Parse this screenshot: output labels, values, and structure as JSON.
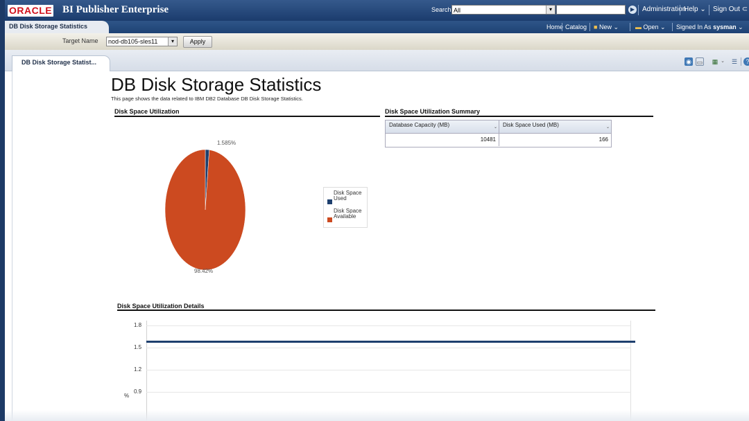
{
  "header": {
    "logo": "ORACLE",
    "app_name": "BI Publisher Enterprise",
    "search_label": "Search",
    "search_scope": "All",
    "links": [
      "Administration",
      "Help",
      "Sign Out"
    ]
  },
  "nav": {
    "active_tab": "DB Disk Storage Statistics",
    "home": "Home",
    "catalog": "Catalog",
    "new": "New",
    "open": "Open",
    "signed_in_label": "Signed In As",
    "user": "sysman"
  },
  "params": {
    "target_name_label": "Target Name",
    "target_name_value": "nod-db105-sles11",
    "apply_label": "Apply"
  },
  "report_tab": "DB Disk Storage Statist...",
  "report": {
    "title": "DB Disk Storage Statistics",
    "description": "This page shows the data related to IBM DB2 Database DB Disk Storage Statistics.",
    "sections": {
      "utilization": "Disk Space Utilization",
      "summary": "Disk Space Utilization Summary",
      "details": "Disk Space Utilization Details"
    },
    "summary_table": {
      "headers": [
        "Database Capacity (MB)",
        "Disk Space Used (MB)"
      ],
      "row": [
        "10481",
        "166"
      ]
    }
  },
  "chart_data": [
    {
      "type": "pie",
      "labels": [
        "1.585%",
        "98.42%"
      ],
      "series": [
        {
          "name": "Disk Space Used",
          "value": 1.585
        },
        {
          "name": "Disk Space Available",
          "value": 98.42
        }
      ],
      "legend": [
        "Disk Space Used",
        "Disk Space Available"
      ],
      "legend_placement": "right",
      "colors": [
        "#1e3f6e",
        "#cc4a20"
      ]
    },
    {
      "type": "line",
      "yticks": [
        "1.8",
        "1.5",
        "1.2",
        "0.9"
      ],
      "ylabel": "%",
      "ylim": [
        0.6,
        1.8
      ],
      "series": [
        {
          "values": [
            1.585,
            1.585
          ]
        }
      ],
      "grid": true,
      "colors": [
        "#1e3f6e"
      ]
    }
  ],
  "colors": {
    "header_blue": "#1b3c6d",
    "oracle_red": "#d0111d"
  }
}
